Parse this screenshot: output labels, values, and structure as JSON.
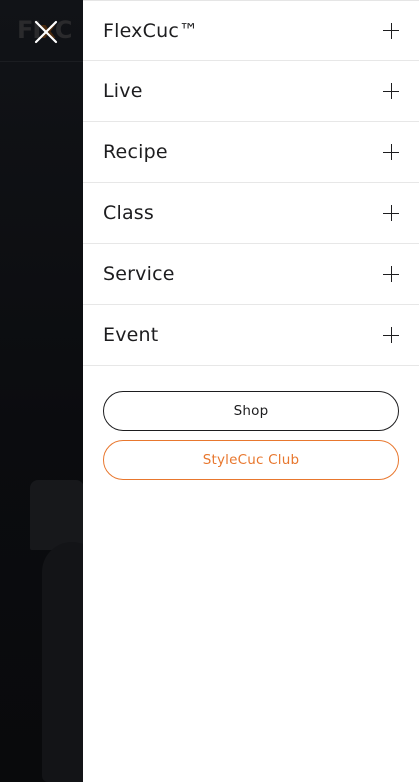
{
  "background": {
    "logo_prefix": "FI",
    "logo_accent": "x",
    "logo_suffix": "C"
  },
  "close_label": "Close menu",
  "menu": {
    "items": [
      {
        "label": "FlexCuc™"
      },
      {
        "label": "Live"
      },
      {
        "label": "Recipe"
      },
      {
        "label": "Class"
      },
      {
        "label": "Service"
      },
      {
        "label": "Event"
      }
    ]
  },
  "actions": {
    "shop_label": "Shop",
    "club_label": "StyleCuc Club"
  },
  "colors": {
    "accent": "#e8772e",
    "text": "#1d1d1f",
    "overlay": "#0b0d10"
  },
  "icons": {
    "close": "close-icon",
    "expand": "plus-icon"
  }
}
